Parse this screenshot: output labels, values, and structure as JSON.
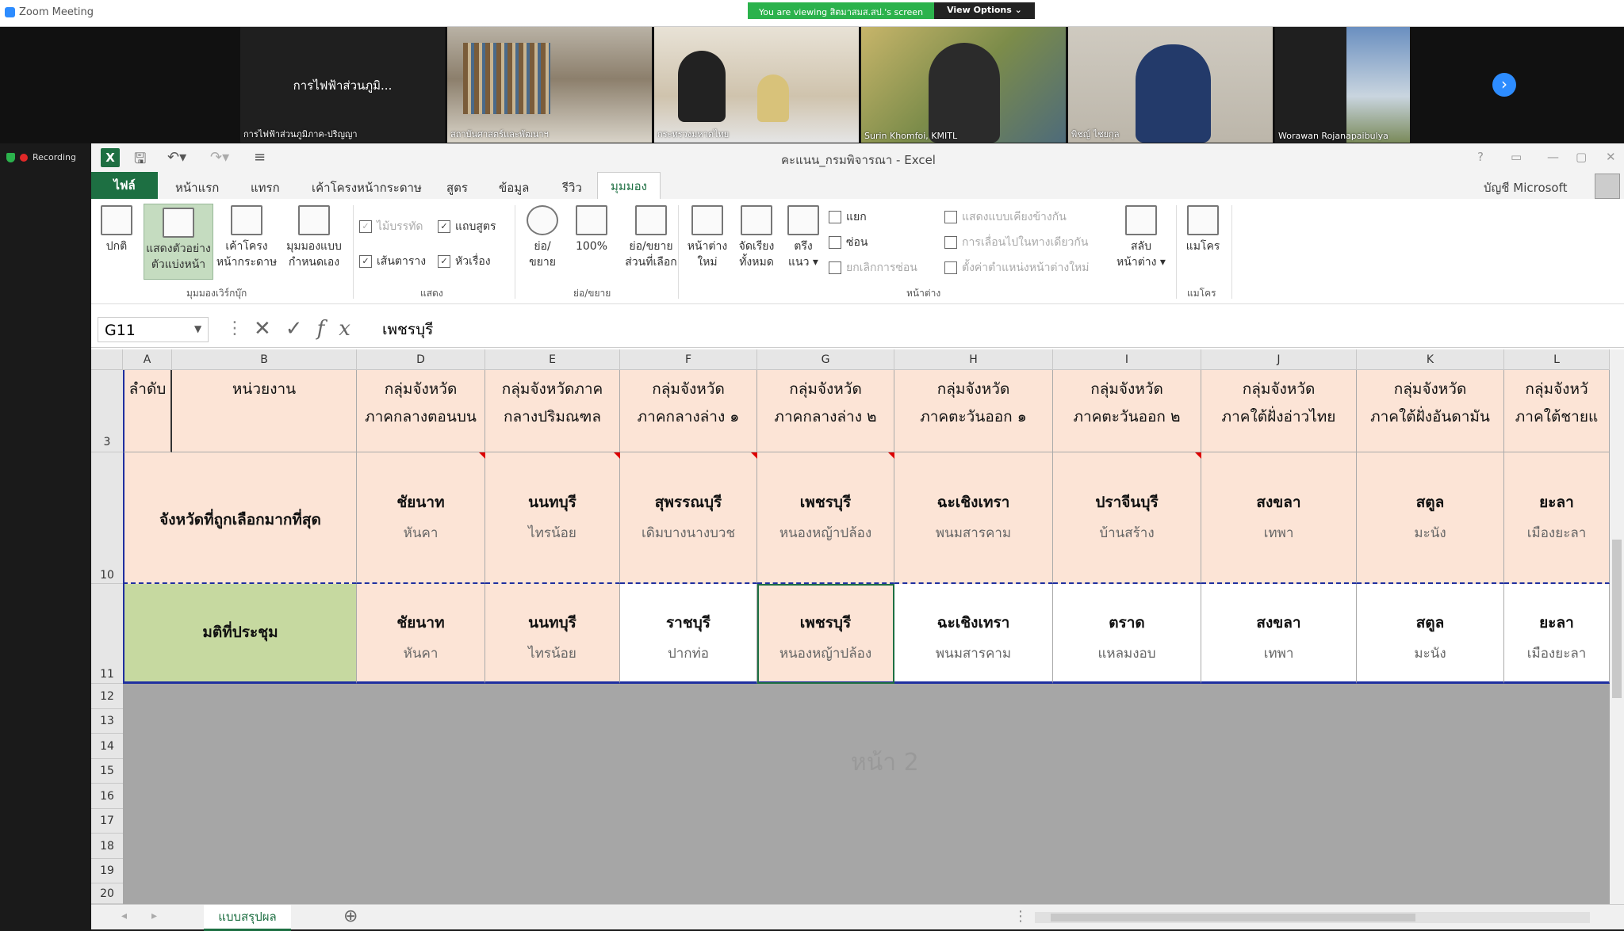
{
  "zoom": {
    "app_title": "Zoom Meeting",
    "viewing_banner": "You are viewing สิตมาสมส.สป.'s screen",
    "view_options": "View Options ⌄",
    "recording": "Recording",
    "participants": [
      {
        "name": "การไฟฟ้าส่วนภูมิ...",
        "label": "การไฟฟ้าส่วนภูมิภาค-ปริญญา"
      },
      {
        "label": "สถาบันศาสตร์และพัฒนาฯ"
      },
      {
        "label": "กระทรวงมหาดไทย"
      },
      {
        "label": "Surin Khomfoi, KMITL"
      },
      {
        "label": "พิชญ์ ไชยกุล"
      },
      {
        "label": "Worawan Rojanapaibulya"
      }
    ]
  },
  "excel": {
    "window_title": "คะแนน_กรมพิจารณา - Excel",
    "logo": "X",
    "account": "บัญชี Microsoft",
    "tabs": [
      "ไฟล์",
      "หน้าแรก",
      "แทรก",
      "เค้าโครงหน้ากระดาษ",
      "สูตร",
      "ข้อมูล",
      "รีวิว",
      "มุมมอง"
    ],
    "ribbon": {
      "normal": "ปกติ",
      "page_break_1": "แสดงตัวอย่าง",
      "page_break_2": "ตัวแบ่งหน้า",
      "page_layout_1": "เค้าโครง",
      "page_layout_2": "หน้ากระดาษ",
      "custom_view_1": "มุมมองแบบ",
      "custom_view_2": "กำหนดเอง",
      "group_workbook": "มุมมองเวิร์กบุ๊ก",
      "ruler": "ไม้บรรทัด",
      "formula_bar": "แถบสูตร",
      "gridlines": "เส้นตาราง",
      "headings": "หัวเรื่อง",
      "group_show": "แสดง",
      "zoom_1": "ย่อ/",
      "zoom_2": "ขยาย",
      "zoom100": "100%",
      "zoom_sel_1": "ย่อ/ขยาย",
      "zoom_sel_2": "ส่วนที่เลือก",
      "group_zoom": "ย่อ/ขยาย",
      "new_window_1": "หน้าต่าง",
      "new_window_2": "ใหม่",
      "arrange_1": "จัดเรียง",
      "arrange_2": "ทั้งหมด",
      "freeze_1": "ตรึง",
      "freeze_2": "แนว ▾",
      "split": "แยก",
      "hide": "ซ่อน",
      "unhide": "ยกเลิกการซ่อน",
      "side_by_side": "แสดงแบบเคียงข้างกัน",
      "sync_scroll": "การเลื่อนไปในทางเดียวกัน",
      "reset_pos": "ตั้งค่าตำแหน่งหน้าต่างใหม่",
      "switch_1": "สลับ",
      "switch_2": "หน้าต่าง ▾",
      "group_window": "หน้าต่าง",
      "macros": "แมโคร",
      "group_macros": "แมโคร"
    },
    "name_box": "G11",
    "formula": "เพชรบุรี",
    "columns": [
      "A",
      "B",
      "D",
      "E",
      "F",
      "G",
      "H",
      "I",
      "J",
      "K",
      "L"
    ],
    "rows": [
      "3",
      "10",
      "11",
      "12",
      "13",
      "14",
      "15",
      "16",
      "17",
      "18",
      "19",
      "20"
    ],
    "header_row": {
      "a": "ลำดับ",
      "b": "หน่วยงาน",
      "groups": [
        [
          "กลุ่มจังหวัด",
          "ภาคกลางตอนบน"
        ],
        [
          "กลุ่มจังหวัดภาค",
          "กลางปริมณฑล"
        ],
        [
          "กลุ่มจังหวัด",
          "ภาคกลางล่าง ๑"
        ],
        [
          "กลุ่มจังหวัด",
          "ภาคกลางล่าง ๒"
        ],
        [
          "กลุ่มจังหวัด",
          "ภาคตะวันออก ๑"
        ],
        [
          "กลุ่มจังหวัด",
          "ภาคตะวันออก ๒"
        ],
        [
          "กลุ่มจังหวัด",
          "ภาคใต้ฝั่งอ่าวไทย"
        ],
        [
          "กลุ่มจังหวัด",
          "ภาคใต้ฝั่งอันดามัน"
        ],
        [
          "กลุ่มจังหวั",
          "ภาคใต้ชายแ"
        ]
      ]
    },
    "row10": {
      "label": "จังหวัดที่ถูกเลือกมากที่สุด",
      "cells": [
        [
          "ชัยนาท",
          "หันคา"
        ],
        [
          "นนทบุรี",
          "ไทรน้อย"
        ],
        [
          "สุพรรณบุรี",
          "เดิมบางนางบวช"
        ],
        [
          "เพชรบุรี",
          "หนองหญ้าปล้อง"
        ],
        [
          "ฉะเชิงเทรา",
          "พนมสารคาม"
        ],
        [
          "ปราจีนบุรี",
          "บ้านสร้าง"
        ],
        [
          "สงขลา",
          "เทพา"
        ],
        [
          "สตูล",
          "มะนัง"
        ],
        [
          "ยะลา",
          "เมืองยะลา"
        ]
      ]
    },
    "row11": {
      "label": "มติที่ประชุม",
      "cells": [
        [
          "ชัยนาท",
          "หันคา"
        ],
        [
          "นนทบุรี",
          "ไทรน้อย"
        ],
        [
          "ราชบุรี",
          "ปากท่อ"
        ],
        [
          "เพชรบุรี",
          "หนองหญ้าปล้อง"
        ],
        [
          "ฉะเชิงเทรา",
          "พนมสารคาม"
        ],
        [
          "ตราด",
          "แหลมงอบ"
        ],
        [
          "สงขลา",
          "เทพา"
        ],
        [
          "สตูล",
          "มะนัง"
        ],
        [
          "ยะลา",
          "เมืองยะลา"
        ]
      ]
    },
    "page_watermark": "หน้า 2",
    "sheet_tab": "แบบสรุปผล"
  }
}
